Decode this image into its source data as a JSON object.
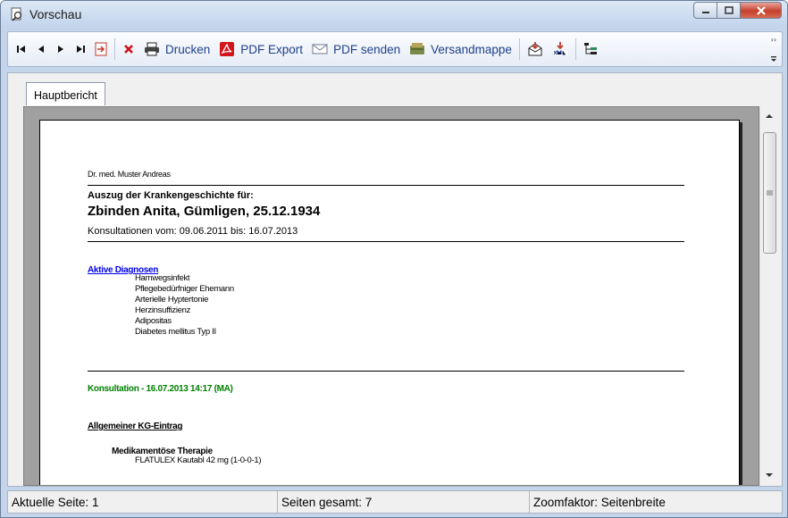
{
  "window": {
    "title": "Vorschau"
  },
  "toolbar": {
    "print_label": "Drucken",
    "pdf_export_label": "PDF Export",
    "pdf_send_label": "PDF senden",
    "mailing_folder_label": "Versandmappe"
  },
  "tabs": [
    {
      "label": "Hauptbericht",
      "active": true
    }
  ],
  "report": {
    "doctor": "Dr. med. Muster Andreas",
    "extract_label": "Auszug der Krankengeschichte für:",
    "patient": "Zbinden Anita, Gümligen, 25.12.1934",
    "consultations_range": "Konsultationen vom: 09.06.2011  bis: 16.07.2013",
    "diagnoses_heading": "Aktive Diagnosen",
    "diagnoses": [
      "Harnwegsinfekt",
      "Pflegebedürfniger Ehemann",
      "Arterielle Hyptertonie",
      "Herzinsuffizienz",
      "Adipositas",
      "Diabetes mellitus Typ II"
    ],
    "consultation_heading": "Konsultation - 16.07.2013 14:17 (MA)",
    "entry_heading": "Allgemeiner KG-Eintrag",
    "therapy_heading": "Medikamentöse Therapie",
    "therapy_line": "FLATULEX Kautabl 42 mg (1-0-0-1)"
  },
  "status": {
    "current_page": "Aktuelle Seite: 1",
    "total_pages": "Seiten gesamt: 7",
    "zoom": "Zoomfaktor: Seitenbreite"
  },
  "colors": {
    "link_blue": "#0000ee",
    "consultation_green": "#008000",
    "toolbar_text": "#1f3f8a"
  }
}
